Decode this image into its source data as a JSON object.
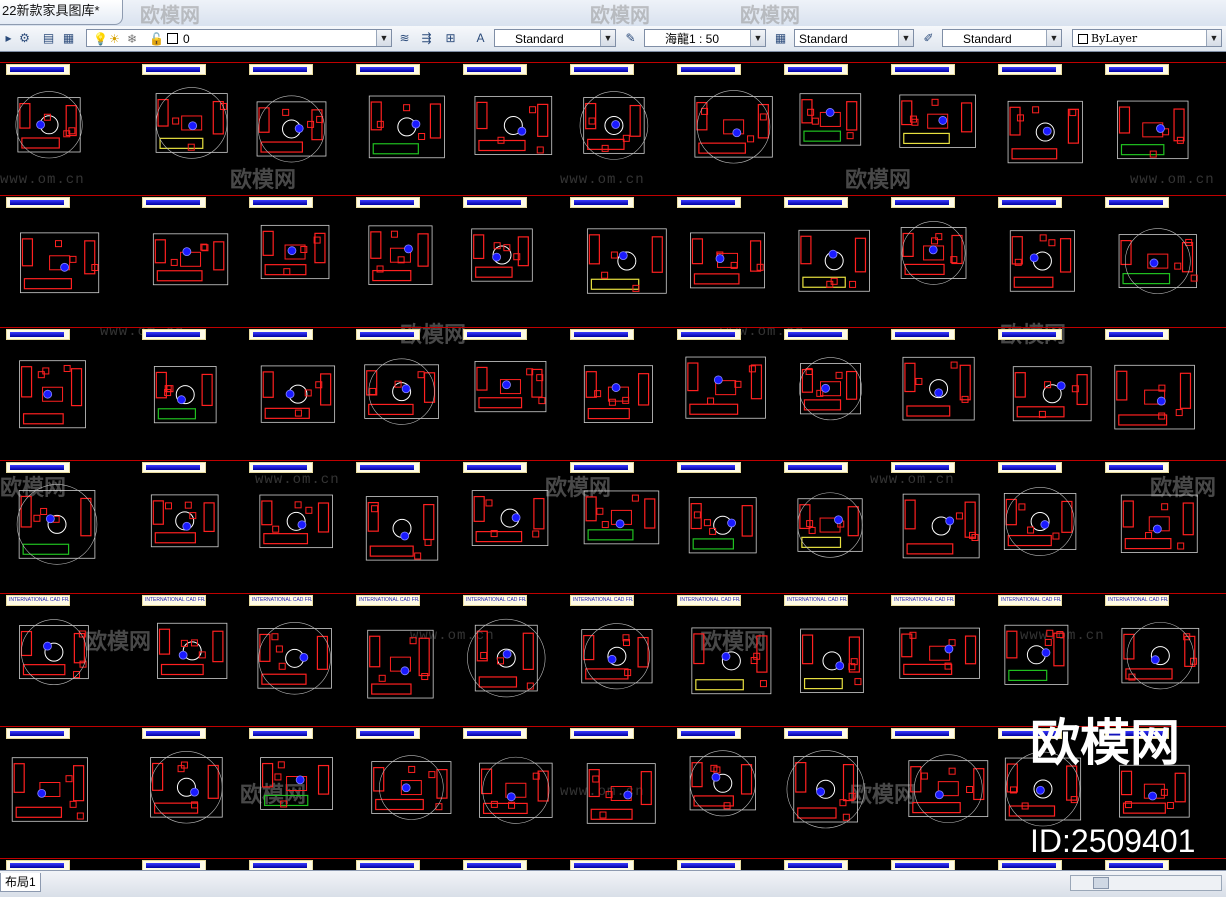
{
  "window": {
    "tab_title": "22新款家具图库*"
  },
  "toolbar": {
    "layer_value": "0",
    "text_style": "Standard",
    "dim_scale": "海龍1 : 50",
    "table_style": "Standard",
    "multileader_style": "Standard",
    "color_value": "ByLayer"
  },
  "drawing": {
    "label_text": "INTERNATIONAL CAD FRAME",
    "colors": {
      "background": "#000000",
      "lines": "#ff2020",
      "accent_blue": "#1a1aff",
      "white": "#ffffff",
      "green": "#20c020",
      "yellow": "#e8e040"
    }
  },
  "watermark": {
    "brand": "欧模网",
    "domain": "www.om.cn",
    "id": "ID:2509401"
  },
  "statusbar": {
    "layout_tab": "布局1"
  }
}
